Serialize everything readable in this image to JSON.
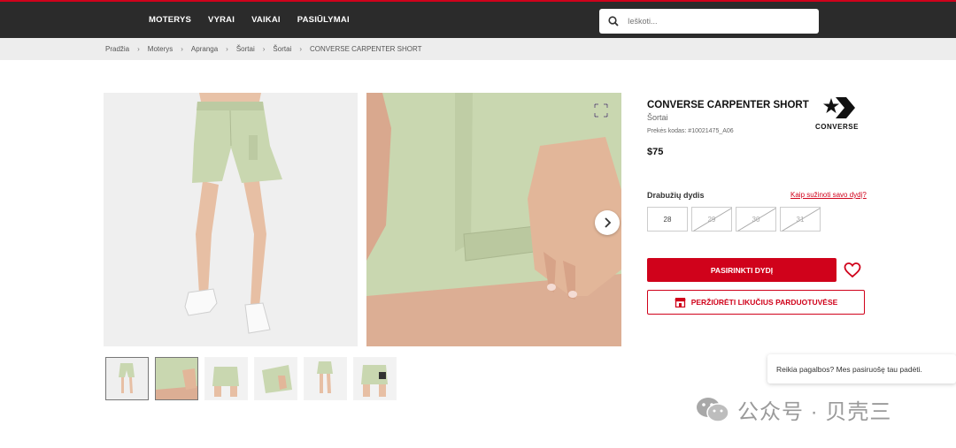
{
  "nav": {
    "items": [
      "MOTERYS",
      "VYRAI",
      "VAIKAI",
      "PASIŪLYMAI"
    ]
  },
  "search": {
    "placeholder": "Ieškoti..."
  },
  "breadcrumb": [
    "Pradžia",
    "Moterys",
    "Apranga",
    "Šortai",
    "Šortai",
    "CONVERSE CARPENTER SHORT"
  ],
  "product": {
    "title": "CONVERSE CARPENTER SHORT",
    "category": "Šortai",
    "code": "Prekės kodas: #10021475_A06",
    "price": "$75",
    "brand": "CONVERSE"
  },
  "sizes": {
    "label": "Drabužių dydis",
    "help": "Kaip sužinoti savo dydį?",
    "options": [
      {
        "label": "28",
        "available": true
      },
      {
        "label": "29",
        "available": false
      },
      {
        "label": "30",
        "available": false
      },
      {
        "label": "31",
        "available": false
      }
    ]
  },
  "actions": {
    "select_size": "PASIRINKTI DYDĮ",
    "check_stores": "PERŽIŪRĖTI LIKUČIUS PARDUOTUVĖSE"
  },
  "help_chat": "Reikia pagalbos? Mes pasiruošę tau padėti.",
  "watermark": "公众号 · 贝壳三",
  "colors": {
    "accent": "#d0021b",
    "header": "#2b2b2b",
    "product": "#c9d7b0"
  }
}
